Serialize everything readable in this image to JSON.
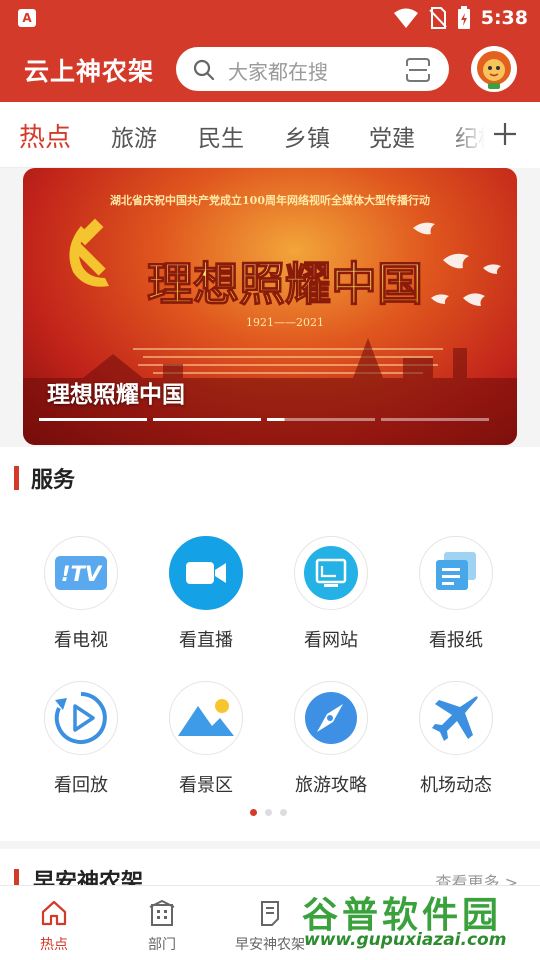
{
  "status_bar": {
    "app_badge": "A",
    "time": "5:38"
  },
  "header": {
    "title": "云上神农架",
    "search_placeholder": "大家都在搜"
  },
  "tabs": [
    {
      "label": "热点",
      "active": true
    },
    {
      "label": "旅游"
    },
    {
      "label": "民生"
    },
    {
      "label": "乡镇"
    },
    {
      "label": "党建"
    },
    {
      "label": "纪检"
    }
  ],
  "banner": {
    "top_line": "湖北省庆祝中国共产党成立100周年网络视听全媒体大型传播行动",
    "headline": "理想照耀中国",
    "years": "1921——2021",
    "caption": "理想照耀中国",
    "slide_count": 4,
    "active_slide": 3
  },
  "services": {
    "title": "服务",
    "items": [
      {
        "label": "看电视",
        "icon": "tv-icon"
      },
      {
        "label": "看直播",
        "icon": "video-camera-icon"
      },
      {
        "label": "看网站",
        "icon": "website-icon"
      },
      {
        "label": "看报纸",
        "icon": "newspaper-icon"
      },
      {
        "label": "看回放",
        "icon": "replay-icon"
      },
      {
        "label": "看景区",
        "icon": "scenery-icon"
      },
      {
        "label": "旅游攻略",
        "icon": "compass-icon"
      },
      {
        "label": "机场动态",
        "icon": "airplane-icon"
      }
    ],
    "pages": 3,
    "active_page": 1
  },
  "morning_section": {
    "title": "早安神农架",
    "more": "查看更多 >"
  },
  "bottom_nav": [
    {
      "label": "热点",
      "icon": "home-icon",
      "active": true
    },
    {
      "label": "部门",
      "icon": "building-icon"
    },
    {
      "label": "早安神农架",
      "icon": "notes-icon"
    }
  ],
  "watermark": {
    "title": "谷普软件园",
    "url": "www.gupuxiazai.com"
  },
  "colors": {
    "brand_red": "#d43a2a",
    "icon_blue": "#2f9be6"
  }
}
